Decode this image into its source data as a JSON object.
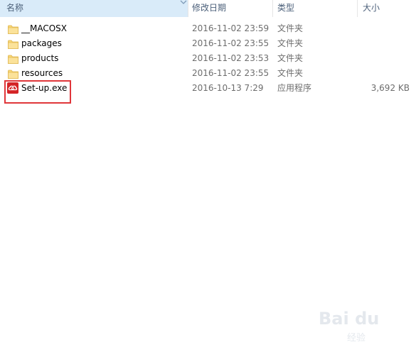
{
  "header": {
    "name": "名称",
    "date": "修改日期",
    "type": "类型",
    "size": "大小"
  },
  "files": [
    {
      "name": "__MACOSX",
      "date": "2016-11-02 23:59",
      "type": "文件夹",
      "size": "",
      "icon": "folder-icon"
    },
    {
      "name": "packages",
      "date": "2016-11-02 23:55",
      "type": "文件夹",
      "size": "",
      "icon": "folder-icon"
    },
    {
      "name": "products",
      "date": "2016-11-02 23:53",
      "type": "文件夹",
      "size": "",
      "icon": "folder-icon"
    },
    {
      "name": "resources",
      "date": "2016-11-02 23:55",
      "type": "文件夹",
      "size": "",
      "icon": "folder-icon"
    },
    {
      "name": "Set-up.exe",
      "date": "2016-10-13 7:29",
      "type": "应用程序",
      "size": "3,692 KB",
      "icon": "creative-cloud-icon"
    }
  ],
  "watermark": {
    "text": "Bai du",
    "sub": "经验"
  },
  "colors": {
    "highlight_border": "#e0363a",
    "folder": "#f8d775",
    "app_red": "#d42427",
    "sorted_header": "#d9ebf9"
  }
}
